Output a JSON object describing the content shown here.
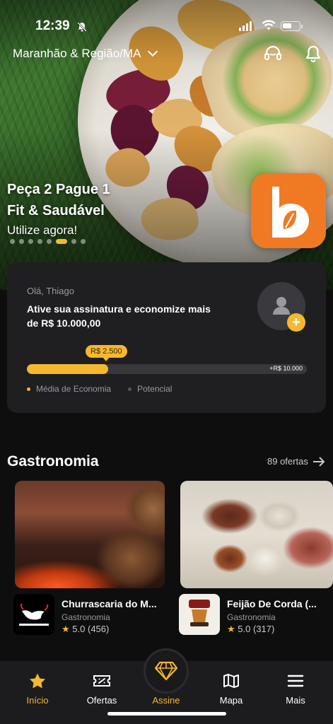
{
  "status_bar": {
    "time": "12:39"
  },
  "header": {
    "location": "Maranhão & Região/MA"
  },
  "banner": {
    "line1": "Peça 2 Pague 1",
    "line2": "Fit & Saudável",
    "cta": "Utilize agora!",
    "slide_count": 8,
    "active_slide": 5
  },
  "savings_card": {
    "greeting": "Olá, Thiago",
    "headline": "Ative sua assinatura e economize mais de  R$ 10.000,00",
    "current_value": "R$ 2.500",
    "max_value": "+R$ 10.000",
    "progress_fraction": 0.29,
    "legend": {
      "average": "Média de Economia",
      "potential": "Potencial"
    }
  },
  "section": {
    "title": "Gastronomia",
    "link_label": "89 ofertas"
  },
  "offers": [
    {
      "name": "Churrascaria do M...",
      "category": "Gastronomia",
      "rating": "5.0",
      "reviews": "(456)",
      "logo_text": "CHURRASCARIA DO MARCONY"
    },
    {
      "name": "Feijão De Corda (...",
      "category": "Gastronomia",
      "rating": "5.0",
      "reviews": "(317)",
      "logo_text": ""
    }
  ],
  "tabbar": {
    "items": [
      {
        "label": "Início",
        "icon": "star-icon"
      },
      {
        "label": "Ofertas",
        "icon": "ticket-icon"
      },
      {
        "label": "Assine",
        "icon": "diamond-icon"
      },
      {
        "label": "Mapa",
        "icon": "map-icon"
      },
      {
        "label": "Mais",
        "icon": "menu-icon"
      }
    ],
    "active": "Início"
  },
  "colors": {
    "accent": "#f5b82e",
    "brand_orange": "#f07a23",
    "background": "#0e0e0f",
    "card": "#1f1f22"
  }
}
